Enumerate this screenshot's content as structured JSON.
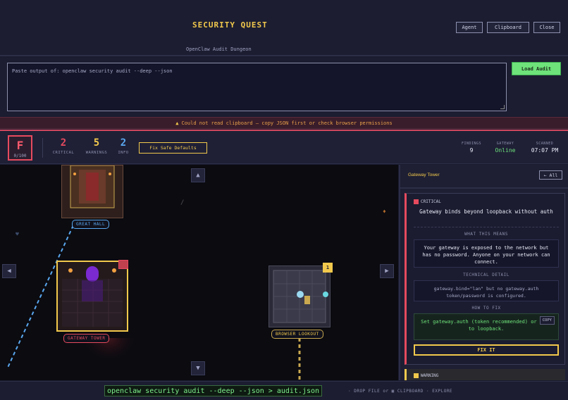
{
  "header": {
    "title": "SECURITY QUEST",
    "subtitle": "OpenClaw Audit Dungeon",
    "buttons": [
      "Agent",
      "Clipboard",
      "Close"
    ]
  },
  "paste": {
    "placeholder": "Paste output of: openclaw security audit --deep --json",
    "load_label": "Load Audit"
  },
  "error": {
    "message": "Could not read clipboard — copy JSON first or check browser permissions"
  },
  "stats": {
    "grade": "F",
    "score": "0/100",
    "critical_count": "2",
    "critical_label": "CRITICAL",
    "warnings_count": "5",
    "warnings_label": "WARNINGS",
    "info_count": "2",
    "info_label": "INFO",
    "fix_label": "Fix Safe Defaults",
    "findings_label": "FINDINGS",
    "findings_value": "9",
    "gateway_label": "GATEWAY",
    "gateway_value": "Online",
    "scanned_label": "SCANNED",
    "scanned_value": "07:07 PM",
    "colors": {
      "critical": "#e64a5e",
      "warnings": "#f2c94c",
      "info": "#5aa8f0",
      "online": "#6ee37a"
    }
  },
  "map": {
    "rooms": [
      {
        "label": "GREAT HALL",
        "status": "info"
      },
      {
        "label": "GATEWAY TOWER",
        "status": "critical"
      },
      {
        "label": "BROWSER LOOKOUT",
        "status": "warning",
        "badge": "1"
      }
    ],
    "nav": {
      "up": "▲",
      "down": "▼",
      "left": "◀",
      "right": "▶"
    }
  },
  "sidebar": {
    "room_title": "Gateway Tower",
    "all_label": "← All",
    "finding": {
      "severity": "CRITICAL",
      "title": "Gateway binds beyond loopback without auth",
      "meaning_label": "WHAT THIS MEANS",
      "meaning": "Your gateway is exposed to the network but has no password. Anyone on your network can connect.",
      "detail_label": "TECHNICAL DETAIL",
      "detail": "gateway.bind=\"lan\" but no gateway.auth token/password is configured.",
      "fix_label": "HOW TO FIX",
      "fix": "Set gateway.auth (token recommended) or bind to loopback.",
      "copy_label": "COPY",
      "fix_button": "FIX IT"
    },
    "next_severity": "WARNING"
  },
  "footer": {
    "command": "openclaw security audit --deep --json > audit.json",
    "hints": "· DROP FILE or ▣ CLIPBOARD · EXPLORE"
  }
}
